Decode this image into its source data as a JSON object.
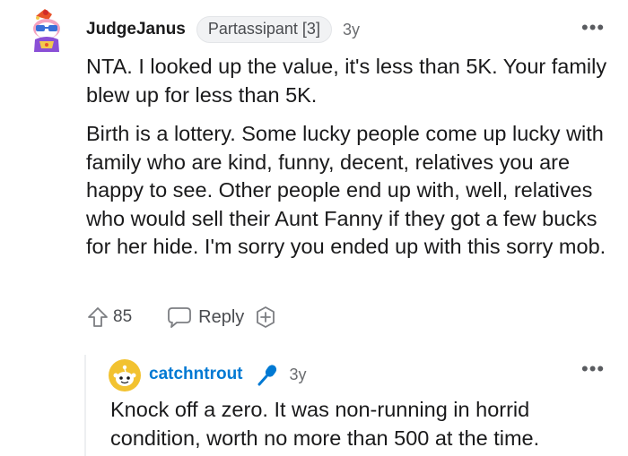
{
  "comment": {
    "author": "JudgeJanus",
    "flair": "Partassipant [3]",
    "age": "3y",
    "avatar_icon": "snoo-avatar-icon",
    "paragraphs": [
      "NTA. I looked up the value, it's less than 5K. Your family blew up for less than 5K.",
      "Birth is a lottery. Some lucky people come up lucky with family who are kind, funny, decent, relatives you are happy to see. Other people end up with, well, relatives who would sell their Aunt Fanny if they got a few bucks for her hide. I'm sorry you ended up with this sorry mob."
    ],
    "actions": {
      "upvote_icon": "upvote-arrow-icon",
      "vote_count": "85",
      "reply_icon": "speech-bubble-icon",
      "reply_label": "Reply",
      "award_icon": "add-award-icon"
    },
    "overflow_icon": "more-options-icon",
    "overflow_glyph": "•••"
  },
  "reply": {
    "author": "catchntrout",
    "author_color": "#0079d3",
    "badge_icon": "microphone-icon",
    "badge_color": "#0079d3",
    "age": "3y",
    "avatar_icon": "snoo-default-avatar-icon",
    "text": "Knock off a zero. It was non-running in horrid condition, worth no more than 500 at the time.",
    "overflow_icon": "more-options-icon",
    "overflow_glyph": "•••"
  }
}
